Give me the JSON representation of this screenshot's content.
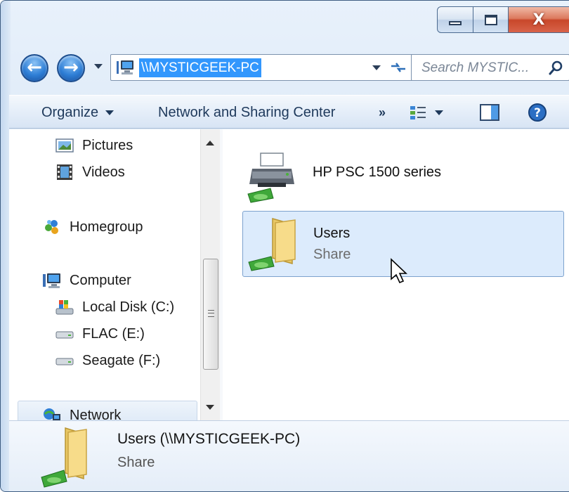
{
  "window": {
    "address": "\\\\MYSTICGEEK-PC",
    "search_placeholder": "Search MYSTIC...",
    "caption": {
      "close": "X"
    }
  },
  "toolbar": {
    "organize": "Organize",
    "network_sharing": "Network and Sharing Center",
    "more": "»"
  },
  "nav_pane": {
    "items": [
      {
        "label": "Pictures",
        "icon": "pictures-icon"
      },
      {
        "label": "Videos",
        "icon": "videos-icon"
      },
      {
        "label": "Homegroup",
        "icon": "homegroup-icon"
      },
      {
        "label": "Computer",
        "icon": "computer-icon"
      },
      {
        "label": "Local Disk (C:)",
        "icon": "local-disk-icon"
      },
      {
        "label": "FLAC (E:)",
        "icon": "drive-icon"
      },
      {
        "label": "Seagate (F:)",
        "icon": "drive-icon"
      },
      {
        "label": "Network",
        "icon": "network-icon"
      }
    ]
  },
  "files": [
    {
      "name": "HP PSC 1500 series",
      "icon": "shared-printer-icon"
    },
    {
      "name": "Users",
      "subtitle": "Share",
      "icon": "shared-folder-icon",
      "selected": true
    }
  ],
  "details": {
    "title": "Users (\\\\MYSTICGEEK-PC)",
    "subtitle": "Share"
  },
  "colors": {
    "selection": "#3297fd",
    "selected_item_bg": "#dcebfc",
    "selected_item_border": "#7da2ce",
    "close_button": "#c8472a"
  }
}
